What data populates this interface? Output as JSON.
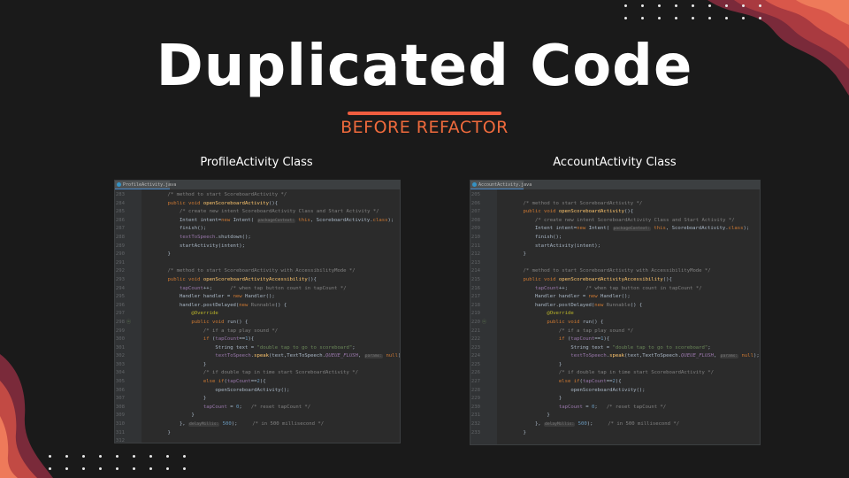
{
  "slide": {
    "title": "Duplicated Code",
    "subtitle": "BEFORE REFACTOR",
    "colors": {
      "background": "#1a1a1a",
      "accent": "#ef5d3f",
      "subtitle": "#ef6a3c"
    }
  },
  "panels": [
    {
      "label": "ProfileActivity Class",
      "tab": "ProfileActivity.java",
      "lines": [
        {
          "n": "283",
          "m": "",
          "t": "    <span class='c'>/* method to start ScoreboardActivity */</span>"
        },
        {
          "n": "284",
          "m": "",
          "t": "    <span class='k'>public void</span> <span class='f'>openScoreboardActivity</span>(){"
        },
        {
          "n": "285",
          "m": "",
          "t": "        <span class='c'>/* create new intent ScoreboardActivity Class and Start Activity */</span>"
        },
        {
          "n": "286",
          "m": "",
          "t": "        Intent intent=<span class='k'>new</span> Intent( <span class='h'>packageContext:</span> <span class='k'>this</span>, ScoreboardActivity.<span class='k'>class</span>);"
        },
        {
          "n": "287",
          "m": "",
          "t": "        finish();"
        },
        {
          "n": "288",
          "m": "",
          "t": "        <span class='p'>textToSpeech</span>.shutdown();"
        },
        {
          "n": "289",
          "m": "",
          "t": "        startActivity(intent);"
        },
        {
          "n": "290",
          "m": "",
          "t": "    }"
        },
        {
          "n": "291",
          "m": "",
          "t": ""
        },
        {
          "n": "292",
          "m": "",
          "t": "    <span class='c'>/* method to start ScoreboardActivity with AccessibilityMode */</span>"
        },
        {
          "n": "293",
          "m": "",
          "t": "    <span class='k'>public void</span> <span class='f'>openScoreboardActivityAccessibility</span>(){"
        },
        {
          "n": "294",
          "m": "",
          "t": "        <span class='p'>tapCount</span>++;      <span class='c'>/* when tap button count in tapCount */</span>"
        },
        {
          "n": "295",
          "m": "",
          "t": "        Handler handler = <span class='k'>new</span> Handler();"
        },
        {
          "n": "296",
          "m": "",
          "t": "        handler.postDelayed(<span class='k'>new</span> <span class='c'>Runnable</span>() {"
        },
        {
          "n": "297",
          "m": "",
          "t": "            <span class='a'>@Override</span>"
        },
        {
          "n": "298",
          "m": "o",
          "t": "            <span class='k'>public void</span> run() {"
        },
        {
          "n": "299",
          "m": "",
          "t": "                <span class='c'>/* if a tap play sound */</span>"
        },
        {
          "n": "300",
          "m": "",
          "t": "                <span class='k'>if</span> (<span class='p'>tapCount</span>==<span class='n'>1</span>){"
        },
        {
          "n": "301",
          "m": "",
          "t": "                    String text = <span class='s'>\"double tap to go to scoreboard\"</span>;"
        },
        {
          "n": "302",
          "m": "",
          "t": "                    <span class='p'>textToSpeech</span>.<span class='f'>speak</span>(text,TextToSpeech.<span class='i'>QUEUE_FLUSH</span>, <span class='h'>params:</span> <span class='k'>null</span>);"
        },
        {
          "n": "303",
          "m": "",
          "t": "                }"
        },
        {
          "n": "304",
          "m": "",
          "t": "                <span class='c'>/* if double tap in time start ScoreboardActivity */</span>"
        },
        {
          "n": "305",
          "m": "",
          "t": "                <span class='k'>else if</span>(<span class='p'>tapCount</span>==<span class='n'>2</span>){"
        },
        {
          "n": "306",
          "m": "",
          "t": "                    openScoreboardActivity();"
        },
        {
          "n": "307",
          "m": "",
          "t": "                }"
        },
        {
          "n": "308",
          "m": "",
          "t": "                <span class='p'>tapCount</span> = <span class='n'>0</span>;   <span class='c'>/* reset tapCount */</span>"
        },
        {
          "n": "309",
          "m": "",
          "t": "            }"
        },
        {
          "n": "310",
          "m": "",
          "t": "        }, <span class='h'>delayMillis:</span> <span class='n'>500</span>);     <span class='c'>/* in 500 millisecond */</span>"
        },
        {
          "n": "311",
          "m": "",
          "t": "    }"
        },
        {
          "n": "312",
          "m": "",
          "t": ""
        }
      ]
    },
    {
      "label": "AccountActivity Class",
      "tab": "AccountActivity.java",
      "lines": [
        {
          "n": "205",
          "m": "",
          "t": ""
        },
        {
          "n": "206",
          "m": "",
          "t": "    <span class='c'>/* method to start ScoreboardActivity */</span>"
        },
        {
          "n": "207",
          "m": "",
          "t": "    <span class='k'>public void</span> <span class='f'>openScoreboardActivity</span>(){"
        },
        {
          "n": "208",
          "m": "",
          "t": "        <span class='c'>/* create new intent ScoreboardActivity Class and Start Activity */</span>"
        },
        {
          "n": "209",
          "m": "",
          "t": "        Intent intent=<span class='k'>new</span> Intent( <span class='h'>packageContext:</span> <span class='k'>this</span>, ScoreboardActivity.<span class='k'>class</span>);"
        },
        {
          "n": "210",
          "m": "",
          "t": "        finish();"
        },
        {
          "n": "211",
          "m": "",
          "t": "        startActivity(intent);"
        },
        {
          "n": "212",
          "m": "",
          "t": "    }"
        },
        {
          "n": "213",
          "m": "",
          "t": ""
        },
        {
          "n": "214",
          "m": "",
          "t": "    <span class='c'>/* method to start ScoreboardActivity with AccessibilityMode */</span>"
        },
        {
          "n": "215",
          "m": "",
          "t": "    <span class='k'>public void</span> <span class='f'>openScoreboardActivityAccessibility</span>(){"
        },
        {
          "n": "216",
          "m": "",
          "t": "        <span class='p'>tapCount</span>++;      <span class='c'>/* when tap button count in tapCount */</span>"
        },
        {
          "n": "217",
          "m": "",
          "t": "        Handler handler = <span class='k'>new</span> Handler();"
        },
        {
          "n": "218",
          "m": "",
          "t": "        handler.postDelayed(<span class='k'>new</span> <span class='c'>Runnable</span>() {"
        },
        {
          "n": "219",
          "m": "",
          "t": "            <span class='a'>@Override</span>"
        },
        {
          "n": "220",
          "m": "o",
          "t": "            <span class='k'>public void</span> run() {"
        },
        {
          "n": "221",
          "m": "",
          "t": "                <span class='c'>/* if a tap play sound */</span>"
        },
        {
          "n": "222",
          "m": "",
          "t": "                <span class='k'>if</span> (<span class='p'>tapCount</span>==<span class='n'>1</span>){"
        },
        {
          "n": "223",
          "m": "",
          "t": "                    String text = <span class='s'>\"double tap to go to scoreboard\"</span>;"
        },
        {
          "n": "224",
          "m": "",
          "t": "                    <span class='p'>textToSpeech</span>.<span class='f'>speak</span>(text,TextToSpeech.<span class='i'>QUEUE_FLUSH</span>, <span class='h'>params:</span> <span class='k'>null</span>);"
        },
        {
          "n": "225",
          "m": "",
          "t": "                }"
        },
        {
          "n": "226",
          "m": "",
          "t": "                <span class='c'>/* if double tap in time start ScoreboardActivity */</span>"
        },
        {
          "n": "227",
          "m": "",
          "t": "                <span class='k'>else if</span>(<span class='p'>tapCount</span>==<span class='n'>2</span>){"
        },
        {
          "n": "228",
          "m": "",
          "t": "                    openScoreboardActivity();"
        },
        {
          "n": "229",
          "m": "",
          "t": "                }"
        },
        {
          "n": "230",
          "m": "",
          "t": "                <span class='p'>tapCount</span> = <span class='n'>0</span>;   <span class='c'>/* reset tapCount */</span>"
        },
        {
          "n": "231",
          "m": "",
          "t": "            }"
        },
        {
          "n": "232",
          "m": "",
          "t": "        }, <span class='h'>delayMillis:</span> <span class='n'>500</span>);     <span class='c'>/* in 500 millisecond */</span>"
        },
        {
          "n": "233",
          "m": "",
          "t": "    }"
        }
      ]
    }
  ]
}
